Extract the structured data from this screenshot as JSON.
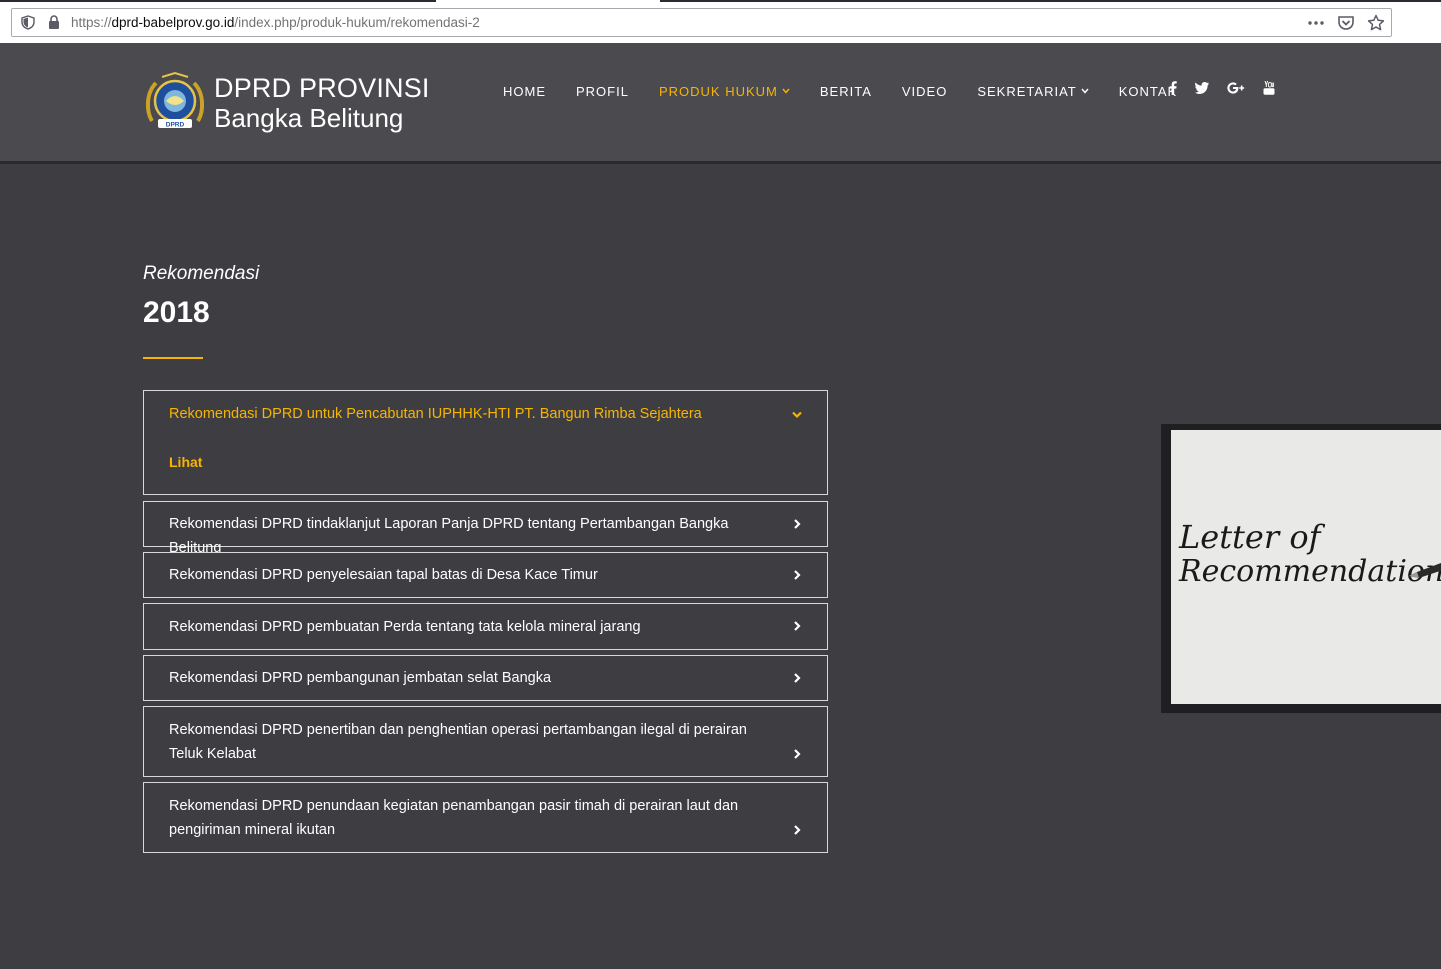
{
  "browser": {
    "url_prefix": "https://",
    "url_host": "dprd-babelprov.go.id",
    "url_path": "/index.php/produk-hukum/rekomendasi-2"
  },
  "header": {
    "brand_line1": "DPRD PROVINSI",
    "brand_line2": "Bangka Belitung",
    "logo_text": "DPRD",
    "nav": [
      {
        "label": "HOME"
      },
      {
        "label": "PROFIL"
      },
      {
        "label": "PRODUK HUKUM",
        "active": true,
        "dropdown": true
      },
      {
        "label": "BERITA"
      },
      {
        "label": "VIDEO"
      },
      {
        "label": "SEKRETARIAT",
        "dropdown": true
      },
      {
        "label": "KONTAK"
      }
    ],
    "social": [
      "facebook-icon",
      "twitter-icon",
      "google-plus-icon",
      "youtube-icon"
    ],
    "accent_color": "#f7b500"
  },
  "main": {
    "subtitle": "Rekomendasi",
    "title": "2018",
    "accordion": [
      {
        "label": "Rekomendasi DPRD untuk Pencabutan IUPHHK-HTI PT. Bangun Rimba Sejahtera",
        "expanded": true,
        "link": "Lihat"
      },
      {
        "label": "Rekomendasi DPRD tindaklanjut Laporan Panja DPRD tentang Pertambangan Bangka Belitung"
      },
      {
        "label": "Rekomendasi DPRD penyelesaian tapal batas di Desa Kace Timur"
      },
      {
        "label": "Rekomendasi DPRD pembuatan Perda tentang tata kelola mineral jarang"
      },
      {
        "label": "Rekomendasi DPRD pembangunan jembatan selat Bangka"
      },
      {
        "label": "Rekomendasi DPRD penertiban dan penghentian operasi pertambangan ilegal di perairan Teluk Kelabat"
      },
      {
        "label": "Rekomendasi DPRD penundaan kegiatan penambangan pasir timah di perairan laut dan pengiriman mineral ikutan"
      }
    ]
  },
  "side_image": {
    "line1": "Letter of",
    "line2": "Recommendation"
  }
}
